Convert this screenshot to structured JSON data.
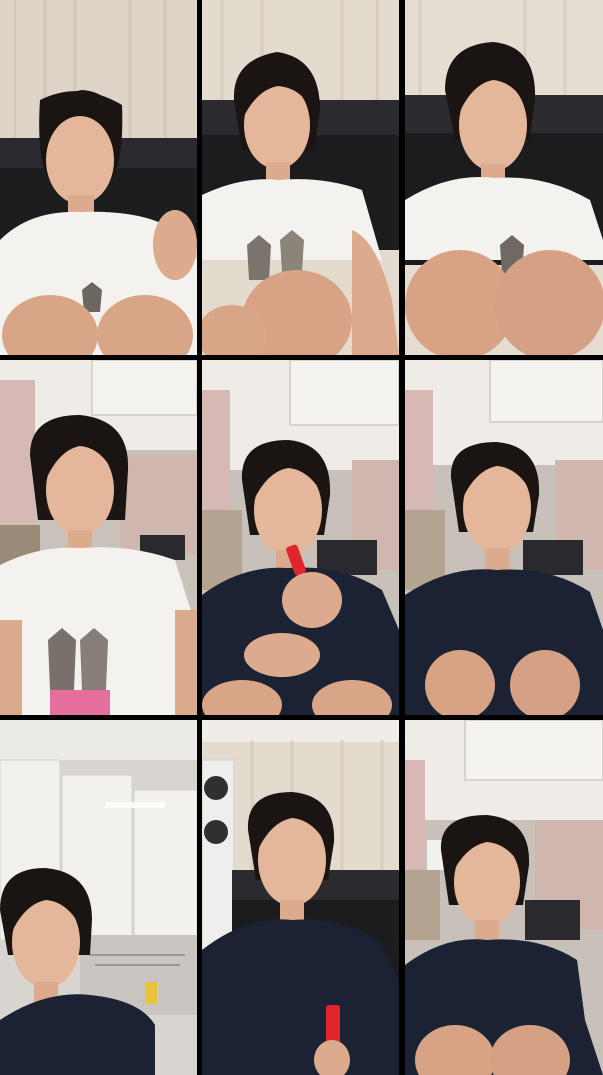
{
  "collage": {
    "rows": 3,
    "columns": 3,
    "background_color": "#000000",
    "frames": [
      {
        "scene": "curtain-sofa",
        "shirt": "white-cat-tee",
        "prop": "none"
      },
      {
        "scene": "curtain-sofa",
        "shirt": "white-cat-tee",
        "prop": "none"
      },
      {
        "scene": "curtain-sofa",
        "shirt": "white-cat-tee",
        "prop": "none"
      },
      {
        "scene": "living-room",
        "shirt": "white-cat-tee",
        "prop": "none"
      },
      {
        "scene": "living-room",
        "shirt": "navy-tee",
        "prop": "red-lip-tint"
      },
      {
        "scene": "living-room",
        "shirt": "navy-tee",
        "prop": "none"
      },
      {
        "scene": "kitchen",
        "shirt": "navy-tee",
        "prop": "none"
      },
      {
        "scene": "curtain-sofa-aircon",
        "shirt": "navy-tee",
        "prop": "red-lip-tint"
      },
      {
        "scene": "living-room",
        "shirt": "navy-tee",
        "prop": "none"
      }
    ]
  },
  "colors": {
    "curtain": "#e6ddd2",
    "sofa": "#1c1c1e",
    "skin": "#e4b69a",
    "hair": "#1a1412",
    "white_shirt": "#f4f2ef",
    "navy_shirt": "#1b2233",
    "ceiling": "#efece8",
    "lip_tint": "#e0262c"
  }
}
